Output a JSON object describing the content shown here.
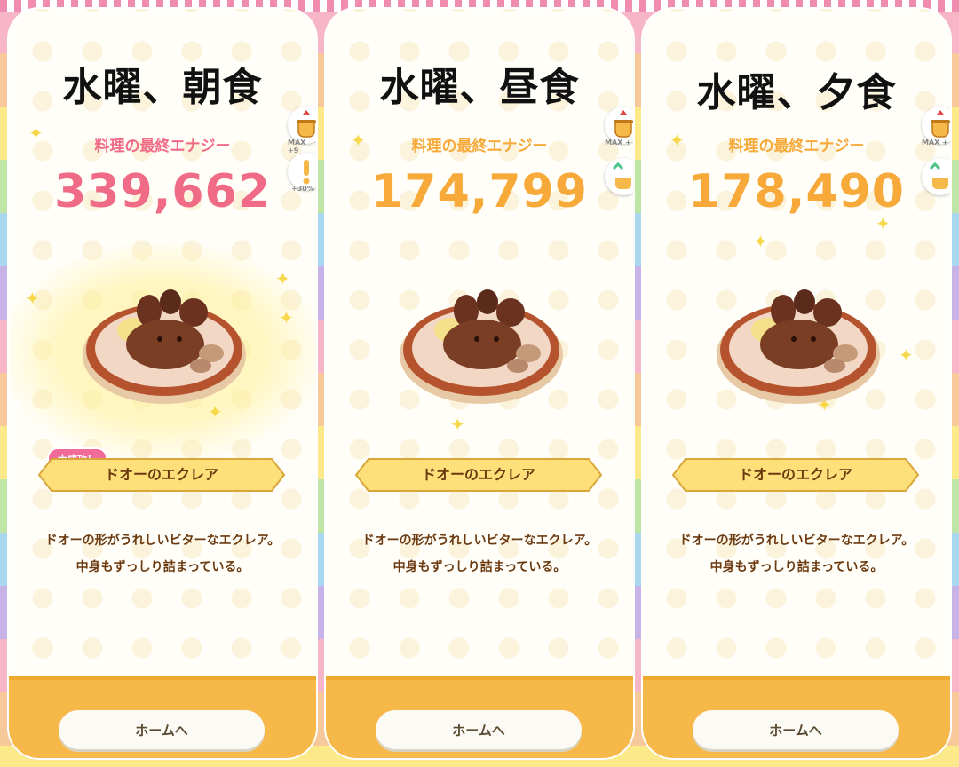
{
  "panels": [
    {
      "title": "水曜、朝食",
      "energy_label": "料理の最終エナジー",
      "energy_value": "339,662",
      "badge": "大成功！",
      "dish_name": "ドオーのエクレア",
      "description_line1": "ドオーの形がうれしいビターなエクレア。",
      "description_line2": "中身もずっしり詰まっている。",
      "home_button": "ホームへ",
      "side_caption_1": "MAX +9",
      "side_caption_2": "+30%",
      "accent_color": "#f06b86"
    },
    {
      "title": "水曜、昼食",
      "energy_label": "料理の最終エナジー",
      "energy_value": "174,799",
      "dish_name": "ドオーのエクレア",
      "description_line1": "ドオーの形がうれしいビターなエクレア。",
      "description_line2": "中身もずっしり詰まっている。",
      "home_button": "ホームへ",
      "side_caption_1": "MAX +",
      "accent_color": "#f7a93a"
    },
    {
      "title": "水曜、夕食",
      "energy_label": "料理の最終エナジー",
      "energy_value": "178,490",
      "dish_name": "ドオーのエクレア",
      "description_line1": "ドオーの形がうれしいビターなエクレア。",
      "description_line2": "中身もずっしり詰まっている。",
      "home_button": "ホームへ",
      "side_caption_1": "MAX +",
      "accent_color": "#f7a93a"
    }
  ],
  "icons": {
    "pot": "pot-icon",
    "exclamation": "exclamation-icon",
    "level_up": "level-up-icon",
    "sparkle": "sparkle-icon"
  }
}
